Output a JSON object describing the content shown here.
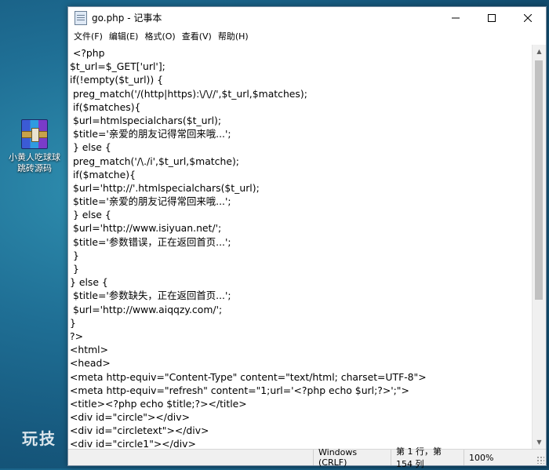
{
  "desktop": {
    "icon_name": "winrar-archive-icon",
    "icon_label_line1": "小黄人吃球球",
    "icon_label_line2": "跳砖源码"
  },
  "watermark": "玩技",
  "window": {
    "title": "go.php - 记事本",
    "controls": {
      "minimize": "minimize-icon",
      "maximize": "maximize-icon",
      "close": "close-icon"
    }
  },
  "menu": [
    "文件(F)",
    "编辑(E)",
    "格式(O)",
    "查看(V)",
    "帮助(H)"
  ],
  "code_lines": [
    " <?php",
    "$t_url=$_GET['url'];",
    "if(!empty($t_url)) {",
    " preg_match('/(http|https):\\/\\//',$t_url,$matches);",
    " if($matches){",
    " $url=htmlspecialchars($t_url);",
    " $title='亲爱的朋友记得常回来哦...';",
    " } else {",
    " preg_match('/\\./i',$t_url,$matche);",
    " if($matche){",
    " $url='http://'.htmlspecialchars($t_url);",
    " $title='亲爱的朋友记得常回来哦...';",
    " } else {",
    " $url='http://www.isiyuan.net/';",
    " $title='参数错误，正在返回首页...';",
    " }",
    " }",
    "} else {",
    " $title='参数缺失，正在返回首页...';",
    " $url='http://www.aiqqzy.com/';",
    "}",
    "?>",
    "<html>",
    "<head>",
    "<meta http-equiv=\"Content-Type\" content=\"text/html; charset=UTF-8\">",
    "<meta http-equiv=\"refresh\" content=\"1;url='<?php echo $url;?>';\">",
    "<title><?php echo $title;?></title>",
    "<div id=\"circle\"></div>",
    "<div id=\"circletext\"></div>",
    "<div id=\"circle1\"></div>"
  ],
  "status": {
    "encoding": "Windows (CRLF)",
    "position": "第 1 行，第 154 列",
    "zoom": "100%"
  }
}
